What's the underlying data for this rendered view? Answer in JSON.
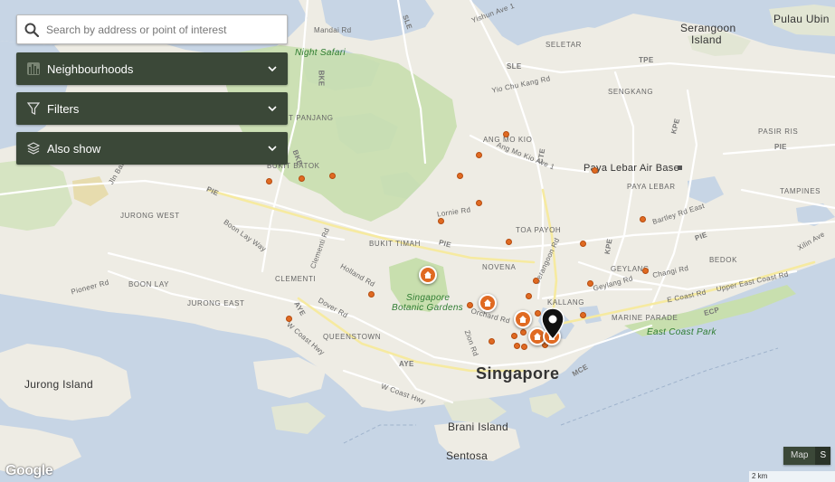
{
  "search": {
    "placeholder": "Search by address or point of interest",
    "icon": "search-icon"
  },
  "dropdowns": [
    {
      "label": "Neighbourhoods",
      "icon": "buildings-icon"
    },
    {
      "label": "Filters",
      "icon": "funnel-icon"
    },
    {
      "label": "Also show",
      "icon": "layers-icon"
    }
  ],
  "map_type": {
    "map_label": "Map",
    "satellite_label": "S"
  },
  "attribution": "Google",
  "scale_label": "2 km",
  "colors": {
    "water": "#c7d5e5",
    "land": "#eeece4",
    "park": "#c8dfae",
    "poi": "#e06a22",
    "panel": "#3b4838"
  },
  "labels": {
    "mandai_rd": "Mandai Rd",
    "night_safari": "Night Safari",
    "yishun_ave1": "Yishun Ave 1",
    "seletar": "SELETAR",
    "sle_top": "SLE",
    "sle_mid": "SLE",
    "serangoon_island_1": "Serangoon",
    "serangoon_island_2": "Island",
    "pulau_ubin": "Pulau Ubin",
    "tpe": "TPE",
    "yio_chu_kang": "Yio Chu Kang Rd",
    "sengkang": "SENGKANG",
    "bke_1": "BKE",
    "bke_2": "BKE",
    "bukit_panjang": "BUKIT PANJANG",
    "choa_chu_kang": "Choa Chu Kang Rd",
    "ang_mo_kio": "ANG MO KIO",
    "ang_mo_kio_ave1": "Ang Mo Kio Ave 1",
    "cte": "CTE",
    "paya_lebar_air_base": "Paya Lebar Air Base",
    "pasir_ris": "PASIR RIS",
    "pie_top": "PIE",
    "kpe_top": "KPE",
    "bukit_batok": "BUKIT BATOK",
    "paya_lebar": "PAYA LEBAR",
    "tampines": "TAMPINES",
    "jurong_west": "JURONG WEST",
    "pie_left": "PIE",
    "jurong_east_west_dot": "Jln Bahar",
    "lornie_rd": "Lornie Rd",
    "toa_payoh": "TOA PAYOH",
    "bartley_rd_east": "Bartley Rd East",
    "bukit_timah": "BUKIT TIMAH",
    "pie_mid": "PIE",
    "boon_lay_way": "Boon Lay Way",
    "clementi_rd": "Clementi Rd",
    "tampines_ave": "Xilin Ave",
    "pie_right": "PIE",
    "kpe_mid": "KPE",
    "novena": "NOVENA",
    "serangoon_rd": "Serangoon Rd",
    "geylang": "GEYLANG",
    "changi_rd": "Changi Rd",
    "bedok": "BEDOK",
    "clementi": "CLEMENTI",
    "holland_rd": "Holland Rd",
    "pioneer_rd": "Pioneer Rd",
    "boon_lay": "BOON LAY",
    "geylang_rd": "Geylang Rd",
    "e_coast_rd": "E Coast Rd",
    "upper_east_coast_rd": "Upper East Coast Rd",
    "jurong_east": "JURONG EAST",
    "botanic_1": "Singapore",
    "botanic_2": "Botanic Gardens",
    "kallang": "KALLANG",
    "dover_rd": "Dover Rd",
    "orchard_rd": "Orchard Rd",
    "marine_parade": "MARINE PARADE",
    "ecp": "ECP",
    "aye_left": "AYE",
    "east_coast_park": "East Coast Park",
    "queenstown": "QUEENSTOWN",
    "zion_rd": "Zion Rd",
    "w_coast_hwy": "W Coast Hwy",
    "aye_mid": "AYE",
    "singapore": "Singapore",
    "mce": "MCE",
    "jurong_island": "Jurong Island",
    "w_coast_hwy_2": "W Coast Hwy",
    "brani_island": "Brani Island",
    "sentosa": "Sentosa",
    "lim_chu_kang": "Lim Chu Kang Rd",
    "kpe_low": "KPE"
  }
}
